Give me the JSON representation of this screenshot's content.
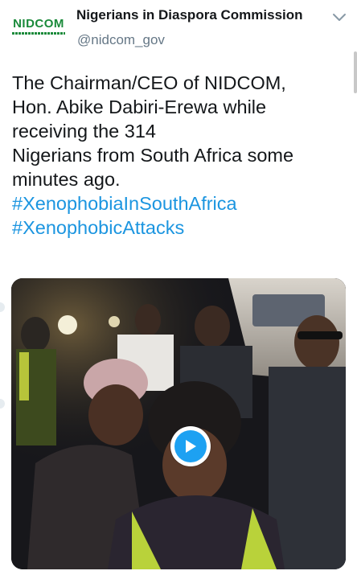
{
  "account": {
    "avatar_logo_text": "NIDCOM",
    "display_name": "Nigerians in Diaspora Commission",
    "handle": "@nidcom_gov"
  },
  "tweet": {
    "lines": [
      "The Chairman/CEO of NIDCOM,",
      "Hon. Abike Dabiri-Erewa while",
      "receiving the 314",
      "Nigerians from South Africa some",
      "minutes ago."
    ],
    "hashtags": [
      "#XenophobiaInSouthAfrica",
      "#XenophobicAttacks"
    ]
  },
  "media": {
    "type": "video",
    "play_icon": "play-icon"
  },
  "icons": {
    "menu": "chevron-down-icon"
  },
  "colors": {
    "brand_green": "#1a8a3a",
    "hashtag": "#1b95e0",
    "play_button": "#1da1f2",
    "secondary_text": "#657786"
  }
}
